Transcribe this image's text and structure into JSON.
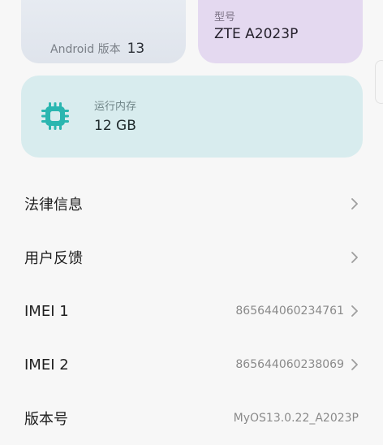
{
  "cards": {
    "android": {
      "label": "Android 版本",
      "value": "13"
    },
    "model": {
      "label": "型号",
      "value": "ZTE A2023P"
    },
    "memory": {
      "label": "运行内存",
      "value": "12 GB"
    }
  },
  "list": [
    {
      "title": "法律信息",
      "value": ""
    },
    {
      "title": "用户反馈",
      "value": ""
    },
    {
      "title": "IMEI 1",
      "value": "865644060234761"
    },
    {
      "title": "IMEI 2",
      "value": "865644060238069"
    },
    {
      "title": "版本号",
      "value": "MyOS13.0.22_A2023P"
    }
  ],
  "colors": {
    "android_card": "#e4e8ef",
    "model_card": "#e4d9f0",
    "memory_card": "#d8ecee",
    "chip_icon": "#2ab6b0"
  },
  "icons": {
    "memory": "memory-chip-icon",
    "chevron": "chevron-right-icon"
  }
}
